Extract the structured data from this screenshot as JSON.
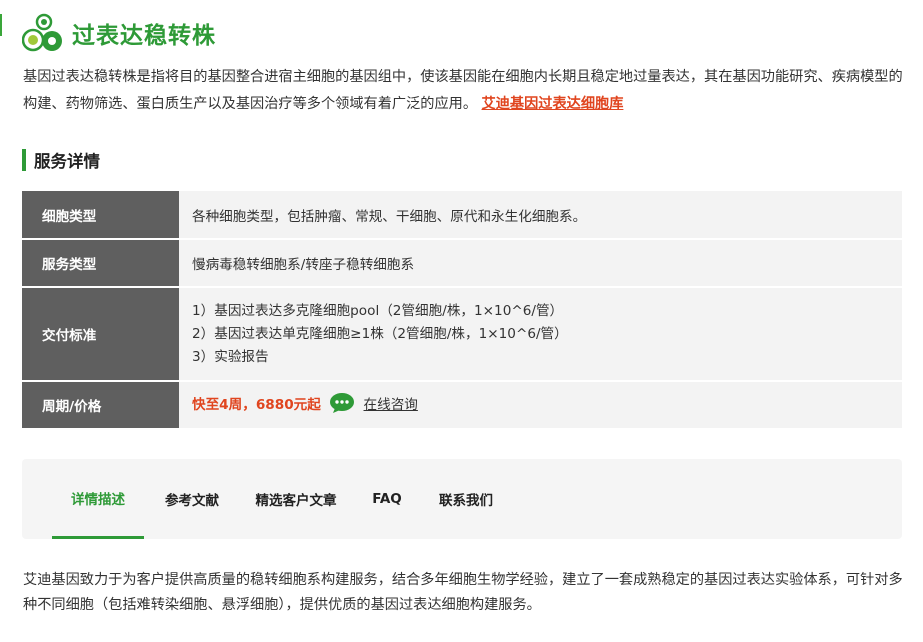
{
  "page": {
    "title": "过表达稳转株",
    "intro_text": "基因过表达稳转株是指将目的基因整合进宿主细胞的基因组中，使该基因能在细胞内长期且稳定地过量表达，其在基因功能研究、疾病模型的构建、药物筛选、蛋白质生产以及基因治疗等多个领域有着广泛的应用。",
    "intro_link": "艾迪基因过表达细胞库"
  },
  "service": {
    "section_title": "服务详情",
    "rows": [
      {
        "key": "细胞类型",
        "value": "各种细胞类型，包括肿瘤、常规、干细胞、原代和永生化细胞系。"
      },
      {
        "key": "服务类型",
        "value": "慢病毒稳转细胞系/转座子稳转细胞系"
      },
      {
        "key": "交付标准",
        "lines": [
          "1）基因过表达多克隆细胞pool（2管细胞/株，1×10^6/管）",
          "2）基因过表达单克隆细胞≥1株（2管细胞/株，1×10^6/管）",
          "3）实验报告"
        ]
      },
      {
        "key": "周期/价格",
        "price": "快至4周，6880元起",
        "consult": "在线咨询"
      }
    ]
  },
  "tabs": [
    {
      "label": "详情描述",
      "active": true
    },
    {
      "label": "参考文献",
      "active": false
    },
    {
      "label": "精选客户文章",
      "active": false
    },
    {
      "label": "FAQ",
      "active": false
    },
    {
      "label": "联系我们",
      "active": false
    }
  ],
  "description": "艾迪基因致力于为客户提供高质量的稳转细胞系构建服务，结合多年细胞生物学经验，建立了一套成熟稳定的基因过表达实验体系，可针对多种不同细胞（包括难转染细胞、悬浮细胞），提供优质的基因过表达细胞构建服务。",
  "colors": {
    "accent_green": "#2e9a37",
    "link_orange": "#e0451f",
    "key_cell_bg": "#5f5f5f",
    "value_cell_bg": "#f3f3f3",
    "tabs_bg": "#f5f5f5"
  },
  "icons": [
    "cells-logo-icon",
    "wechat-chat-icon"
  ]
}
